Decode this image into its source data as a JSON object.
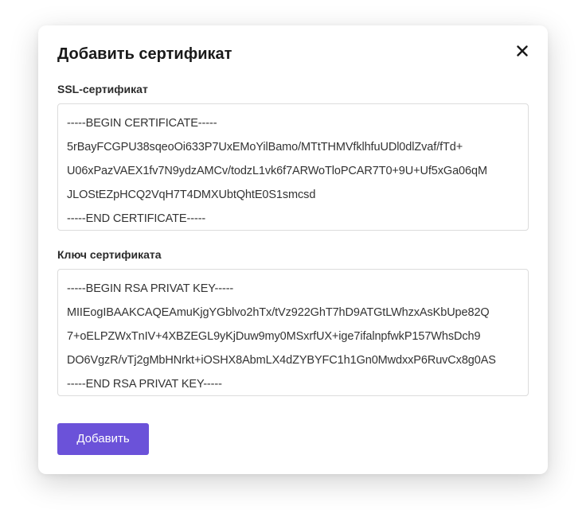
{
  "dialog": {
    "title": "Добавить сертификат",
    "close_icon": "close-icon",
    "submit_label": "Добавить",
    "accent_color": "#6b52d9"
  },
  "ssl_certificate": {
    "label": "SSL-сертификат",
    "lines": [
      "-----BEGIN CERTIFICATE-----",
      "5rBayFCGPU38sqeoOi633P7UxEMoYilBamo/MTtTHMVfklhfuUDl0dlZvaf/fTd+",
      "U06xPazVAEX1fv7N9ydzAMCv/todzL1vk6f7ARWoTloPCAR7T0+9U+Uf5xGa06qM",
      "JLOStEZpHCQ2VqH7T4DMXUbtQhtE0S1smcsd",
      "-----END CERTIFICATE-----"
    ]
  },
  "certificate_key": {
    "label": "Ключ сертификата",
    "lines": [
      "-----BEGIN RSA PRIVAT KEY-----",
      "MIIEogIBAAKCAQEAmuKjgYGblvo2hTx/tVz922GhT7hD9ATGtLWhzxAsKbUpe82Q",
      "7+oELPZWxTnIV+4XBZEGL9yKjDuw9my0MSxrfUX+ige7ifalnpfwkP157WhsDch9",
      "DO6VgzR/vTj2gMbHNrkt+iOSHX8AbmLX4dZYBYFC1h1Gn0MwdxxP6RuvCx8g0AS",
      "-----END RSA PRIVAT KEY-----"
    ]
  }
}
